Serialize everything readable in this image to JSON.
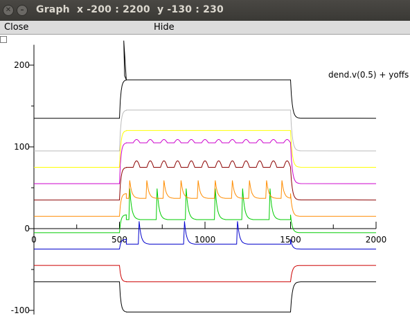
{
  "window": {
    "title": "Graph  x -200 : 2200  y -130 : 230"
  },
  "menu": {
    "close_label": "Close",
    "hide_label": "Hide"
  },
  "chart_data": {
    "type": "line",
    "xlim": [
      -200,
      2200
    ],
    "ylim": [
      -130,
      230
    ],
    "x_ticks": [
      0,
      500,
      1000,
      1500,
      2000
    ],
    "x_tick_labels": [
      "0",
      "500",
      "1000",
      "1500",
      "2000"
    ],
    "y_ticks": [
      -100,
      0,
      100,
      200
    ],
    "y_tick_labels": [
      "-100",
      "0",
      "100",
      "200"
    ],
    "legend_text": "dend.v(0.5) + yoffs",
    "stim_window": [
      500,
      1500
    ],
    "grid": false,
    "series": [
      {
        "color": "#000000",
        "base": -65,
        "step": -37,
        "shape": "plateau"
      },
      {
        "color": "#cc0000",
        "base": -45,
        "step": -20,
        "shape": "plateau"
      },
      {
        "color": "#0000cc",
        "base": -25,
        "step": 12,
        "shape": "spikes",
        "spike_times": [
          615,
          880,
          1190
        ],
        "spike_height": 28
      },
      {
        "color": "#00cc00",
        "base": -5,
        "step": 22,
        "shape": "spikes",
        "spike_times": [
          560,
          720,
          890,
          1060,
          1220,
          1380
        ],
        "spike_height": 38
      },
      {
        "color": "#ff8c00",
        "base": 15,
        "step": 28,
        "shape": "spikes",
        "spike_times": [
          560,
          660,
          760,
          860,
          960,
          1060,
          1160,
          1260,
          1360,
          1450
        ],
        "spike_height": 22
      },
      {
        "color": "#8b0000",
        "base": 35,
        "step": 40,
        "shape": "bumps",
        "period": 80,
        "amp": 8
      },
      {
        "color": "#cc00cc",
        "base": 55,
        "step": 50,
        "shape": "bumps",
        "period": 80,
        "amp": 4
      },
      {
        "color": "#ffff00",
        "base": 75,
        "step": 45,
        "shape": "plateau"
      },
      {
        "color": "#bbbbbb",
        "base": 95,
        "step": 50,
        "shape": "plateau"
      },
      {
        "color": "#000000",
        "base": 135,
        "step": 47,
        "shape": "plateau",
        "peak": 230
      }
    ]
  }
}
